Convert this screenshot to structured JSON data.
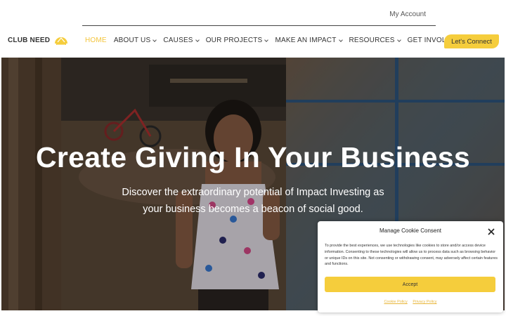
{
  "header": {
    "account_link": "My Account",
    "logo_text": "CLUB NEED",
    "cta_label": "Let's Connect"
  },
  "nav": {
    "items": [
      {
        "label": "HOME",
        "active": true,
        "dropdown": false
      },
      {
        "label": "ABOUT US",
        "active": false,
        "dropdown": true
      },
      {
        "label": "CAUSES",
        "active": false,
        "dropdown": true
      },
      {
        "label": "OUR PROJECTS",
        "active": false,
        "dropdown": true
      },
      {
        "label": "MAKE AN IMPACT",
        "active": false,
        "dropdown": true
      },
      {
        "label": "RESOURCES",
        "active": false,
        "dropdown": true
      },
      {
        "label": "GET INVOLVED",
        "active": false,
        "dropdown": true
      }
    ]
  },
  "hero": {
    "title": "Create Giving In Your Business",
    "subtitle_line1": "Discover the extraordinary potential of Impact Investing as",
    "subtitle_line2": "your business becomes a beacon of social good."
  },
  "cookie_banner": {
    "title": "Manage Cookie Consent",
    "body": "To provide the best experiences, we use technologies like cookies to store and/or access device information. Consenting to these technologies will allow us to process data such as browsing behavior or unique IDs on this site. Not consenting or withdrawing consent, may adversely affect certain features and functions.",
    "accept_label": "Accept",
    "cookie_policy_label": "Cookie Policy",
    "privacy_policy_label": "Privacy Policy"
  },
  "colors": {
    "accent": "#f5cd3c",
    "nav_active": "#f3c43b",
    "text": "#333333"
  }
}
